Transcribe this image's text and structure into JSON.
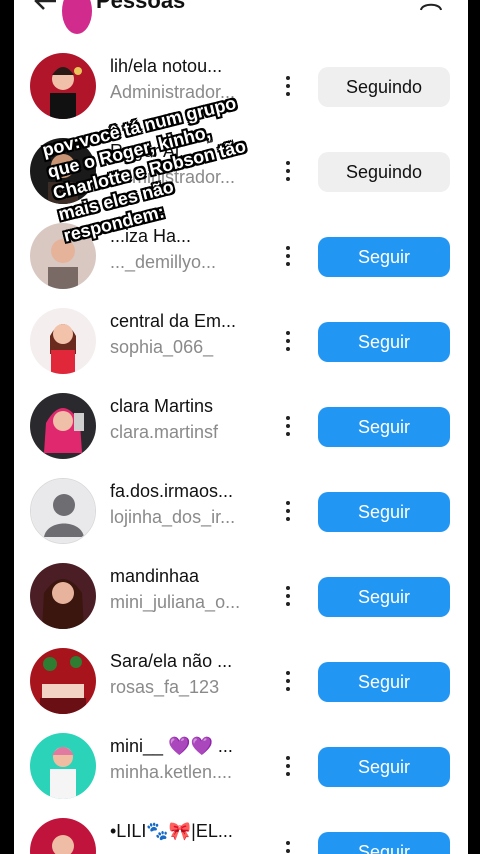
{
  "header": {
    "title": "Pessoas"
  },
  "colors": {
    "follow_blue": "#2196f3",
    "following_gray": "#efefef"
  },
  "overlay_text": "pov:você tá num grupo que o Roger, kinho, Charlotte e Robson tão mais eles não respondem:",
  "people": [
    {
      "name": "lih/ela notou...",
      "username": "Administrador...",
      "button": "Seguindo"
    },
    {
      "name": "Roger Al...",
      "username": "Administrador...",
      "button": "Seguindo"
    },
    {
      "name": "...iza Ha...",
      "username": "..._demillyo...",
      "button": "Seguir"
    },
    {
      "name": "central da Em...",
      "username": "sophia_066_",
      "button": "Seguir"
    },
    {
      "name": "clara Martins",
      "username": "clara.martinsf",
      "button": "Seguir"
    },
    {
      "name": "fa.dos.irmaos...",
      "username": "lojinha_dos_ir...",
      "button": "Seguir"
    },
    {
      "name": "mandinhaa",
      "username": "mini_juliana_o...",
      "button": "Seguir"
    },
    {
      "name": "Sara/ela não ...",
      "username": "rosas_fa_123",
      "button": "Seguir"
    },
    {
      "name": "mini__ 💜💜 ...",
      "username": "minha.ketlen....",
      "button": "Seguir"
    },
    {
      "name": "•LILI🐾🎀|EL...",
      "username": "",
      "button": "Seguir"
    }
  ]
}
